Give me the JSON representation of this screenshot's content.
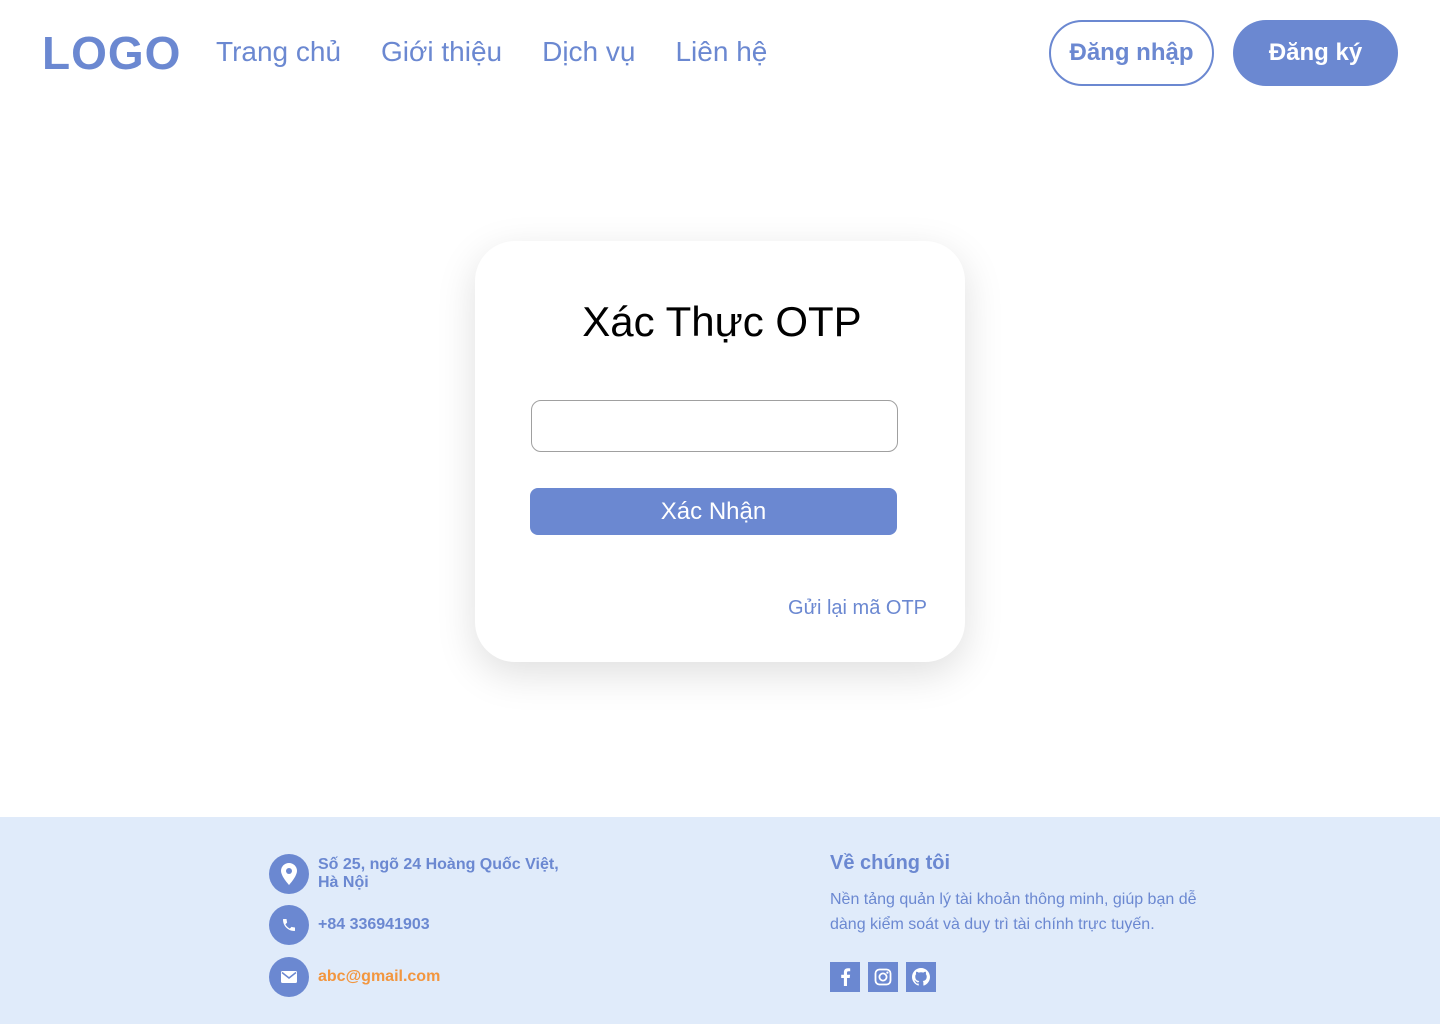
{
  "header": {
    "logo": "LOGO",
    "nav": [
      {
        "label": "Trang chủ"
      },
      {
        "label": "Giới thiệu"
      },
      {
        "label": "Dịch vụ"
      },
      {
        "label": "Liên hệ"
      }
    ],
    "login_label": "Đăng nhập",
    "register_label": "Đăng ký"
  },
  "otp_card": {
    "title": "Xác Thực OTP",
    "input_value": "",
    "confirm_label": "Xác Nhận",
    "resend_label": "Gửi lại mã OTP"
  },
  "footer": {
    "address_line1": "Số 25,  ngõ 24 Hoàng Quốc Việt,",
    "address_line2": "Hà Nội",
    "phone": "+84 336941903",
    "email": "abc@gmail.com",
    "about_title": "Về chúng tôi",
    "about_desc": "Nền tảng quản lý tài khoản thông minh, giúp bạn dễ dàng kiểm soát và duy trì tài chính trực tuyến.",
    "socials": [
      "facebook-icon",
      "instagram-icon",
      "github-icon"
    ]
  },
  "colors": {
    "accent": "#6b88d1",
    "footer_bg": "#e0ebfa",
    "email": "#f2963f"
  }
}
